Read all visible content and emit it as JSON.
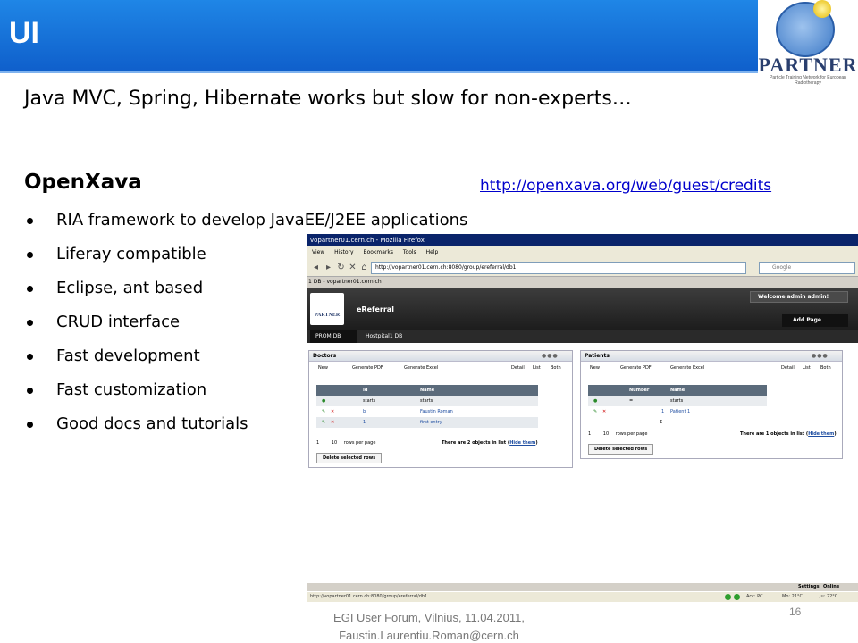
{
  "slide": {
    "title": "UI",
    "logo_text": "PARTNER",
    "logo_subtext": "Particle Training Network for European Radiotherapy",
    "headline": "Java MVC, Spring, Hibernate works but slow for non-experts…",
    "subhead": "OpenXava",
    "credits_link": "http://openxava.org/web/guest/credits",
    "bullets": [
      "RIA framework to develop JavaEE/J2EE applications",
      "Liferay compatible",
      "Eclipse, ant based",
      "CRUD interface",
      "Fast development",
      "Fast customization",
      "Good docs and tutorials"
    ],
    "footer_line1": "EGI User Forum, Vilnius, 11.04.2011,",
    "footer_line2": "Faustin.Laurentiu.Roman@cern.ch",
    "page_number": "16"
  },
  "screenshot": {
    "window_title": "vopartner01.cern.ch - Mozilla Firefox",
    "menu": [
      "View",
      "History",
      "Bookmarks",
      "Tools",
      "Help"
    ],
    "url": "http://vopartner01.cern.ch:8080/group/ereferral/db1",
    "search_placeholder": "Google",
    "tab_title": "1 DB - vopartner01.cern.ch",
    "site_name": "eReferral",
    "welcome": "Welcome admin admin!",
    "add_page": "Add Page",
    "nav_tabs": [
      "PROM DB",
      "Hostpital1 DB"
    ],
    "doctors": {
      "title": "Doctors",
      "toolbar": [
        "New",
        "Generate PDF",
        "Generate Excel",
        "Detail",
        "List",
        "Both"
      ],
      "columns": [
        "Id",
        "Name"
      ],
      "filters": [
        "starts",
        "starts"
      ],
      "rows": [
        {
          "id": "b",
          "name": "Faustin Roman"
        },
        {
          "id": "1",
          "name": "first entry"
        }
      ],
      "page": "1",
      "rows_per_page_value": "10",
      "rows_per_page_label": "rows per page",
      "count_text": "There are 2 objects in list (",
      "hide_link": "Hide them",
      "count_close": ")",
      "delete_button": "Delete selected rows"
    },
    "patients": {
      "title": "Patients",
      "toolbar": [
        "New",
        "Generate PDF",
        "Generate Excel",
        "Detail",
        "List",
        "Both"
      ],
      "columns": [
        "Number",
        "Name"
      ],
      "filters": [
        "=",
        "starts"
      ],
      "rows": [
        {
          "id": "1",
          "name": "Patient 1"
        }
      ],
      "sum_label": "Σ",
      "page": "1",
      "rows_per_page_value": "10",
      "rows_per_page_label": "rows per page",
      "count_text": "There are 1 objects in list (",
      "hide_link": "Hide them",
      "count_close": ")",
      "delete_button": "Delete selected rows"
    },
    "bottom_tabs": [
      "Settings",
      "Online Friends"
    ],
    "status_url": "http://vopartner01.cern.ch:8080/group/ereferral/db1",
    "status_items": [
      "Acc: PC",
      "Mo: 21°C",
      "Ju: 22°C"
    ]
  },
  "colors": {
    "title_bar": "#1677e0",
    "link": "#0000cc",
    "liferay_header": "#2b2b2b",
    "table_header": "#5b6b7b"
  }
}
